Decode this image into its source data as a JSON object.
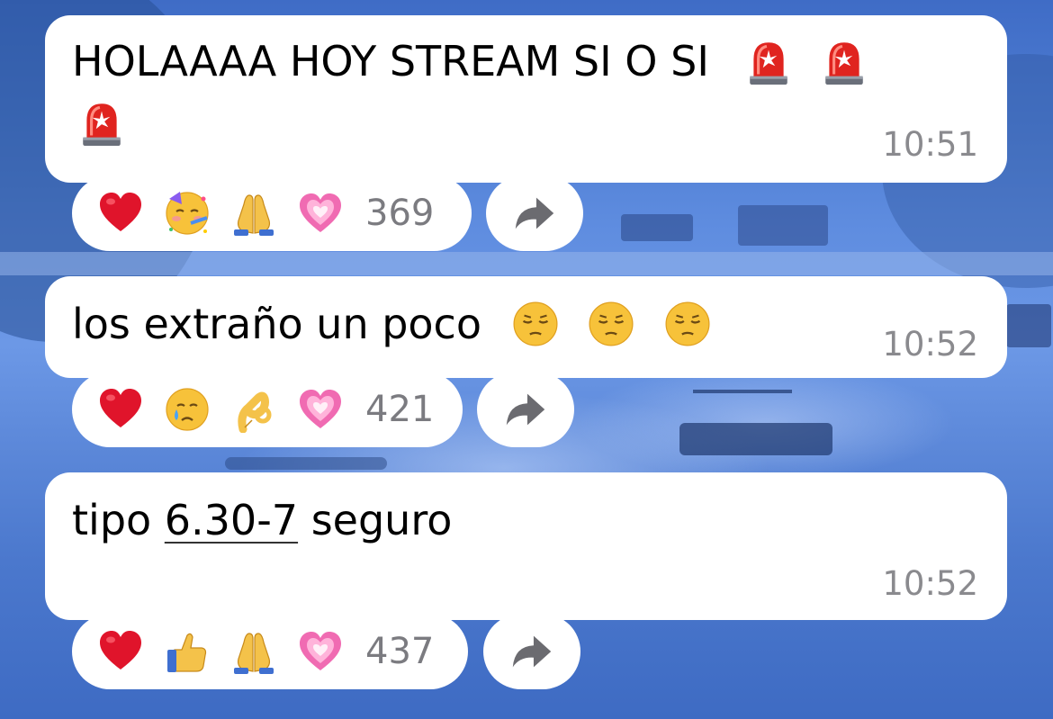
{
  "messages": [
    {
      "text": "HOLAAAA HOY STREAM SI O SI",
      "emojis": [
        "rotating-light-icon",
        "rotating-light-icon",
        "rotating-light-icon"
      ],
      "time": "10:51",
      "reactions": [
        "heart-icon",
        "partying-face-icon",
        "folded-hands-icon",
        "growing-heart-icon"
      ],
      "reaction_count": "369"
    },
    {
      "text": "los extraño un poco",
      "emojis": [
        "pensive-face-icon",
        "pensive-face-icon",
        "pensive-face-icon"
      ],
      "time": "10:52",
      "reactions": [
        "heart-icon",
        "crying-face-icon",
        "ok-hand-icon",
        "growing-heart-icon"
      ],
      "reaction_count": "421"
    },
    {
      "text_before": "tipo ",
      "text_link": "6.30-7",
      "text_after": " seguro",
      "time": "10:52",
      "reactions": [
        "heart-icon",
        "thumbs-up-icon",
        "folded-hands-icon",
        "growing-heart-icon"
      ],
      "reaction_count": "437"
    }
  ],
  "colors": {
    "bubble": "#ffffff",
    "time_text": "#8a8a8e",
    "count_text": "#7b7b80",
    "background": "#5f8de0"
  }
}
